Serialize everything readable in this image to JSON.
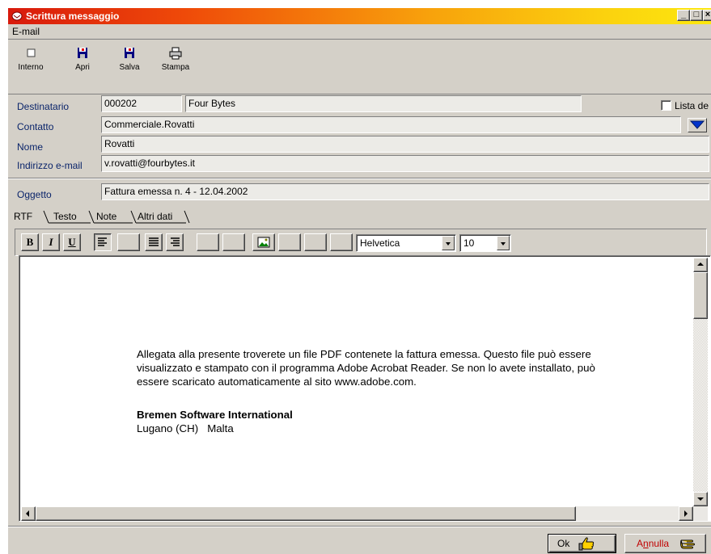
{
  "window": {
    "title": "Scrittura messaggio"
  },
  "menu": {
    "email": "E-mail"
  },
  "toolbar": {
    "interno": "Interno",
    "apri": "Apri",
    "salva": "Salva",
    "stampa": "Stampa"
  },
  "form": {
    "destinatario_label": "Destinatario",
    "destinatario_code": "000202",
    "destinatario_name": "Four Bytes",
    "lista_label": "Lista de",
    "contatto_label": "Contatto",
    "contatto_value": "Commerciale.Rovatti",
    "nome_label": "Nome",
    "nome_value": "Rovatti",
    "email_label": "Indirizzo e-mail",
    "email_value": "v.rovatti@fourbytes.it",
    "oggetto_label": "Oggetto",
    "oggetto_value": "Fattura emessa n. 4 - 12.04.2002"
  },
  "tabs": [
    "RTF",
    "Testo",
    "Note",
    "Altri dati"
  ],
  "format": {
    "bold": "B",
    "italic": "I",
    "underline": "U",
    "font": "Helvetica",
    "size": "10"
  },
  "body": {
    "line1": "Allegata alla presente troverete un file PDF contenete la fattura emessa. Questo file può essere",
    "line2": "visualizzato e stampato con il programma Adobe Acrobat Reader. Se non lo avete installato, può",
    "line3": "essere scaricato automaticamente al sito www.adobe.com.",
    "company": "Bremen Software International",
    "locations": "Lugano (CH)   Malta"
  },
  "buttons": {
    "ok": "Ok",
    "annulla_a": "A",
    "annulla_n": "n",
    "annulla_rest": "nulla"
  },
  "colors": {
    "label_blue": "#0a246a",
    "cancel_red": "#c00000",
    "title_start": "#d81a0c",
    "title_end": "#fce80e"
  }
}
